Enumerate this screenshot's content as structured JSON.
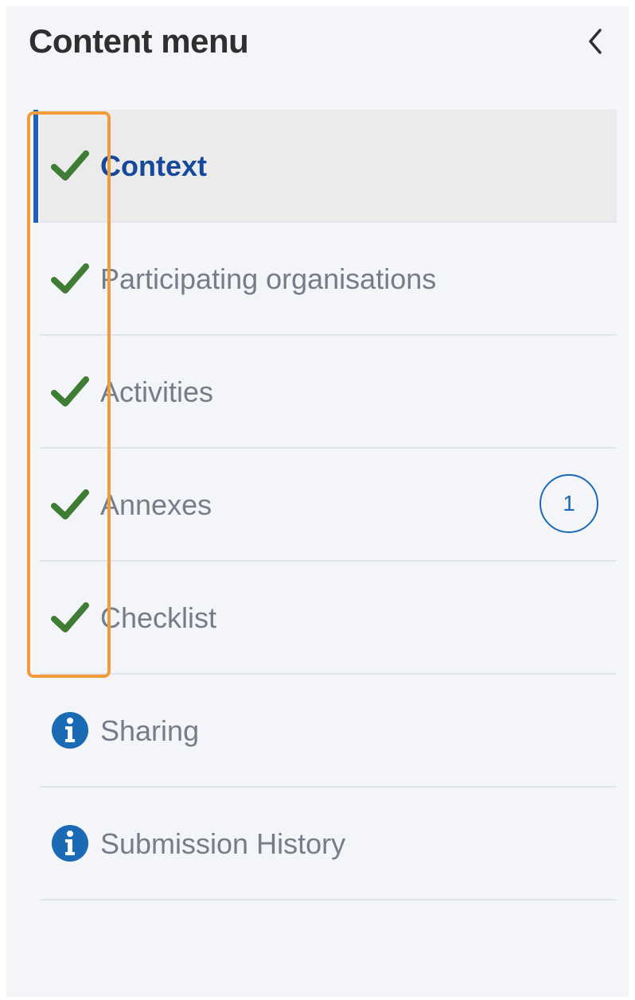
{
  "panel": {
    "title": "Content menu",
    "collapse_icon": "chevron-left-icon"
  },
  "menu": {
    "items": [
      {
        "label": "Context",
        "status_icon": "check-icon",
        "active": true
      },
      {
        "label": "Participating organisations",
        "status_icon": "check-icon",
        "active": false
      },
      {
        "label": "Activities",
        "status_icon": "check-icon",
        "active": false
      },
      {
        "label": "Annexes",
        "status_icon": "check-icon",
        "active": false,
        "badge": "1"
      },
      {
        "label": "Checklist",
        "status_icon": "check-icon",
        "active": false
      },
      {
        "label": "Sharing",
        "status_icon": "info-icon",
        "active": false
      },
      {
        "label": "Submission History",
        "status_icon": "info-icon",
        "active": false
      }
    ]
  },
  "colors": {
    "panel_background": "#f3f5f9",
    "active_text": "#17499a",
    "active_bar": "#1d63b5",
    "check_green": "#3f7d35",
    "info_blue": "#1a6ab5",
    "highlight_orange": "#f39a3a"
  }
}
